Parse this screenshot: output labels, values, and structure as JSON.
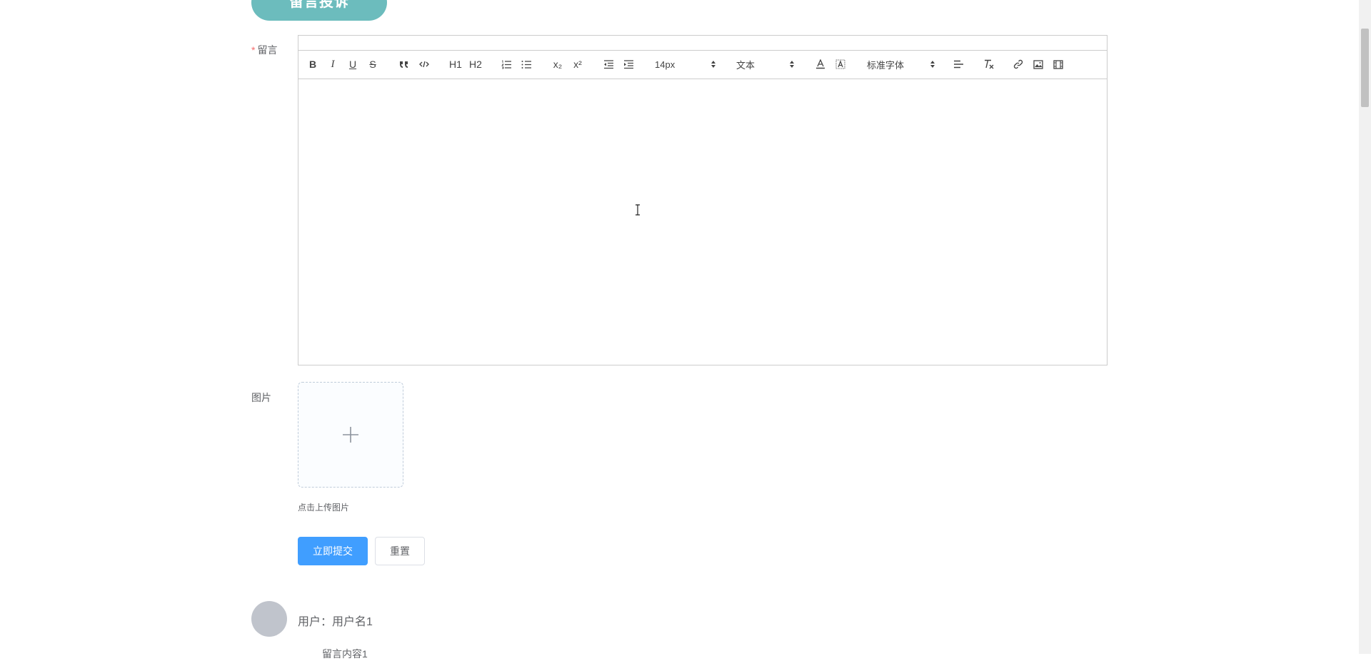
{
  "header": {
    "top_button_label": "留言投诉"
  },
  "form": {
    "message_label": "留言",
    "required_mark": "*",
    "editor": {
      "toolbar": {
        "bold": "B",
        "italic": "I",
        "underline": "U",
        "strike": "S",
        "header1": "H1",
        "header2": "H2",
        "subscript": "x₂",
        "superscript": "x²",
        "font_size": "14px",
        "header_select": "文本",
        "font_family": "标准字体"
      },
      "icons": [
        "bold-icon",
        "italic-icon",
        "underline-icon",
        "strike-icon",
        "blockquote-icon",
        "code-block-icon",
        "header1-icon",
        "header2-icon",
        "ordered-list-icon",
        "bullet-list-icon",
        "subscript-icon",
        "superscript-icon",
        "outdent-icon",
        "indent-icon",
        "font-color-icon",
        "background-color-icon",
        "align-icon",
        "clean-format-icon",
        "link-icon",
        "image-icon",
        "video-icon"
      ]
    },
    "image_label": "图片",
    "upload_tip": "点击上传图片",
    "submit_label": "立即提交",
    "reset_label": "重置"
  },
  "comments": [
    {
      "user_line": "用户：用户名1",
      "content": "留言内容1"
    }
  ],
  "colors": {
    "teal_button": "#6cbcbd",
    "primary": "#409eff",
    "required": "#f56c6c",
    "avatar": "#c0c4cc"
  }
}
